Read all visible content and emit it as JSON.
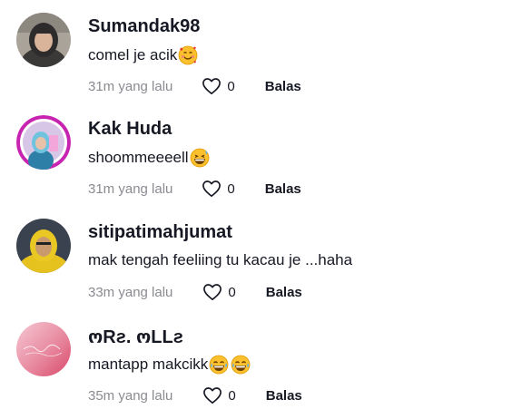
{
  "comments": [
    {
      "username": "Sumandak98",
      "text": "comel je acik",
      "emojis": [
        "smiling-face-with-hearts-emoji"
      ],
      "time": "31m yang lalu",
      "likes": "0",
      "reply_label": "Balas"
    },
    {
      "username": "Kak Huda",
      "text": "shoommeeeell",
      "emojis": [
        "grinning-sweat-emoji"
      ],
      "time": "31m yang lalu",
      "likes": "0",
      "reply_label": "Balas"
    },
    {
      "username": "sitipatimahjumat",
      "text": "mak tengah feeliing tu kacau je ...haha",
      "emojis": [],
      "time": "33m yang lalu",
      "likes": "0",
      "reply_label": "Balas"
    },
    {
      "username": "ოRƨ. ოLLƨ",
      "text": "mantapp makcikk",
      "emojis": [
        "tears-of-joy-emoji",
        "tears-of-joy-emoji"
      ],
      "time": "35m yang lalu",
      "likes": "0",
      "reply_label": "Balas"
    }
  ],
  "icons": {
    "like": "heart-outline-icon"
  },
  "colors": {
    "text": "#161823",
    "secondary_text": "#8a8b91",
    "icon": "#161823"
  }
}
